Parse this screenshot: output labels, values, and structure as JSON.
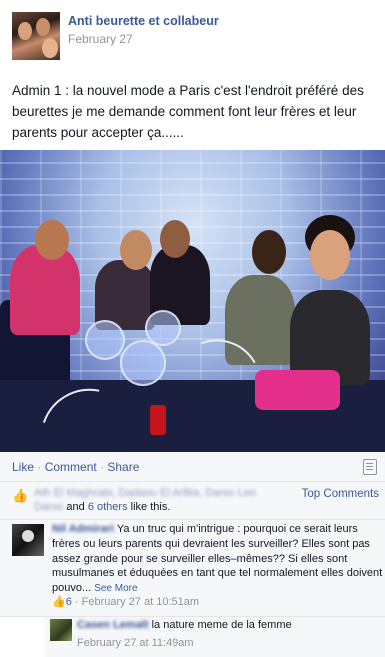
{
  "post": {
    "page_name": "Anti beurette et collabeur",
    "date": "February 27",
    "text": "Admin 1 : la nouvel mode a Paris c'est l'endroit préféré des beurettes je me demande comment font leur frères et leur parents pour accepter ça......"
  },
  "actions": {
    "like": "Like",
    "comment": "Comment",
    "share": "Share",
    "separator": " · "
  },
  "likes": {
    "names_blurred": "Ath El Maghrabi, Dadaou El ArBia, Darso Leo Darso",
    "and_text": "and",
    "others_link": "6 others",
    "like_suffix": "like this.",
    "top_comments": "Top Comments"
  },
  "comments": [
    {
      "author_blurred": "Nil Admirari",
      "text": "Ya un truc qui m'intrigue : pourquoi ce serait leurs frères ou leurs parents qui devraient les surveiller? Elles sont pas assez grande pour se surveiller elles–mêmes?? Si elles sont musulmanes et éduquées en tant que tel normalement elles doivent pouvo...",
      "see_more": "See More",
      "like_count": "6",
      "meta_sep": " · ",
      "timestamp": "February 27 at 10:51am"
    }
  ],
  "reply": {
    "author_blurred": "Casen Lemaît",
    "text": "la nature meme de la femme",
    "timestamp": "February 27 at 11:49am"
  },
  "icons": {
    "thumb": "thumbs-up-icon",
    "share_menu": "share-menu-icon"
  },
  "colors": {
    "link": "#3b5998",
    "meta": "#90949c",
    "panel": "#f6f7f9"
  }
}
